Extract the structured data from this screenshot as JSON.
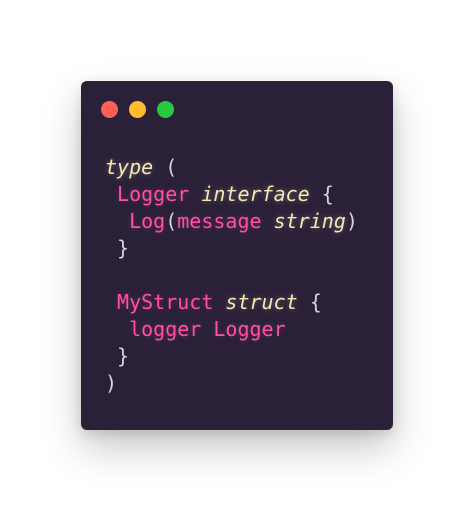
{
  "window": {
    "background": "#2a2139",
    "traffic_lights": [
      {
        "name": "close",
        "color": "#ff5f56"
      },
      {
        "name": "minimize",
        "color": "#ffbd2e"
      },
      {
        "name": "maximize",
        "color": "#27c93f"
      }
    ]
  },
  "code": {
    "lines": [
      [
        {
          "t": "type",
          "k": "kw"
        },
        {
          "t": " (",
          "k": "p"
        }
      ],
      [
        {
          "t": " ",
          "k": "p"
        },
        {
          "t": "Logger",
          "k": "id"
        },
        {
          "t": " ",
          "k": "p"
        },
        {
          "t": "interface",
          "k": "kw"
        },
        {
          "t": " {",
          "k": "p"
        }
      ],
      [
        {
          "t": "  ",
          "k": "p"
        },
        {
          "t": "Log",
          "k": "id"
        },
        {
          "t": "(",
          "k": "p"
        },
        {
          "t": "message",
          "k": "id"
        },
        {
          "t": " ",
          "k": "p"
        },
        {
          "t": "string",
          "k": "kw"
        },
        {
          "t": ")",
          "k": "p"
        }
      ],
      [
        {
          "t": " }",
          "k": "p"
        }
      ],
      [
        {
          "t": "",
          "k": "p"
        }
      ],
      [
        {
          "t": " ",
          "k": "p"
        },
        {
          "t": "MyStruct",
          "k": "id"
        },
        {
          "t": " ",
          "k": "p"
        },
        {
          "t": "struct",
          "k": "kw"
        },
        {
          "t": " {",
          "k": "p"
        }
      ],
      [
        {
          "t": "  ",
          "k": "p"
        },
        {
          "t": "logger Logger",
          "k": "id"
        }
      ],
      [
        {
          "t": " }",
          "k": "p"
        }
      ],
      [
        {
          "t": ")",
          "k": "p"
        }
      ]
    ],
    "colors": {
      "keyword": "#f6e7b4",
      "identifier": "#ff4fa8",
      "punctuation": "#d6d2dc"
    }
  }
}
